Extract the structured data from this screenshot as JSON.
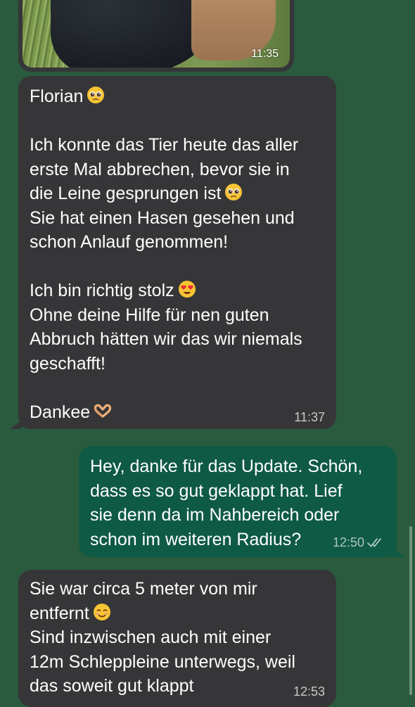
{
  "conversation": {
    "image_message": {
      "time": "11:35"
    },
    "messages": [
      {
        "direction": "incoming",
        "lines": [
          "Florian",
          "",
          "Ich konnte das Tier heute das aller",
          "erste Mal abbrechen, bevor sie in",
          "die Leine gesprungen ist",
          "Sie hat einen Hasen gesehen und",
          "schon Anlauf genommen!",
          "",
          "Ich bin richtig stolz",
          "Ohne deine Hilfe für nen guten",
          "Abbruch hätten wir das wir niemals",
          "geschafft!",
          "",
          "Dankee"
        ],
        "time": "11:37"
      },
      {
        "direction": "outgoing",
        "lines": [
          "Hey, danke für das Update. Schön,",
          "dass es so gut geklappt hat. Lief",
          "sie denn da im Nahbereich oder",
          "schon im weiteren Radius?"
        ],
        "time": "12:50",
        "status_icon": "double-check-icon"
      },
      {
        "direction": "incoming",
        "lines": [
          "Sie war circa 5 meter von mir",
          "entfernt",
          "Sind inzwischen auch mit einer",
          "12m Schleppleine unterwegs, weil",
          "das soweit gut klappt"
        ],
        "time": "12:53"
      }
    ]
  },
  "colors": {
    "background": "#2a5b3f",
    "incoming_bubble": "#363638",
    "outgoing_bubble": "#0f5a45",
    "text": "#ffffff"
  },
  "icons": {
    "pleading": "pleading-face-emoji-icon",
    "heart_eyes": "heart-eyes-emoji-icon",
    "heart_hands": "heart-hands-emoji-icon",
    "smiling": "smiling-face-emoji-icon",
    "read_receipt": "double-check-icon"
  }
}
